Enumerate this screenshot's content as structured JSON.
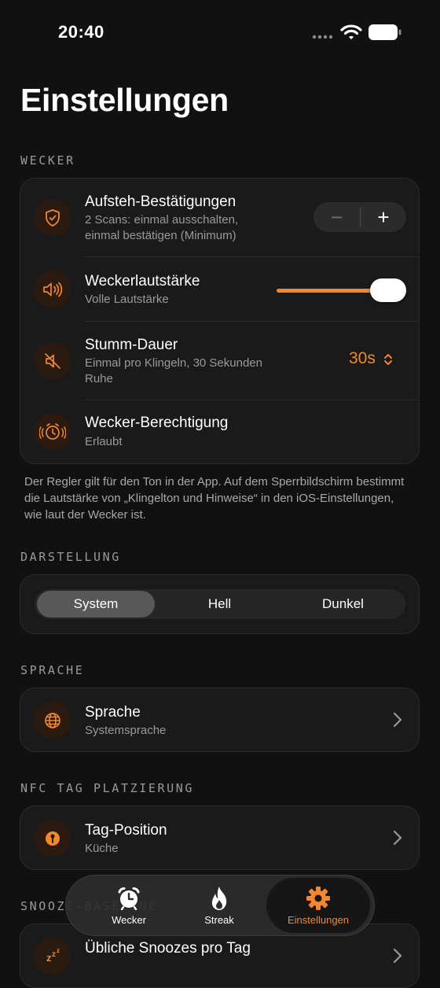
{
  "status_bar": {
    "time": "20:40"
  },
  "page_title": "Einstellungen",
  "sections": {
    "wecker": {
      "label": "WECKER",
      "rows": [
        {
          "icon": "shield-check-icon",
          "title": "Aufsteh-Bestätigungen",
          "subtitle": "2 Scans: einmal ausschalten,\neinmal bestätigen (Minimum)",
          "stepper": {
            "minus": "−",
            "plus": "+"
          }
        },
        {
          "icon": "speaker-volume-icon",
          "title": "Weckerlautstärke",
          "subtitle": "Volle Lautstärke",
          "slider_value": 1.0
        },
        {
          "icon": "muted-speaker-icon",
          "title": "Stumm-Dauer",
          "subtitle": "Einmal pro Klingeln, 30 Sekunden\nRuhe",
          "value": "30s"
        },
        {
          "icon": "alarm-clock-icon",
          "title": "Wecker-Berechtigung",
          "subtitle": "Erlaubt"
        }
      ],
      "footnote": "Der Regler gilt für den Ton in der App. Auf dem Sperrbildschirm bestimmt die Lautstärke von „Klingelton und Hinweise“ in den iOS-Einstellungen, wie laut der Wecker ist."
    },
    "darstellung": {
      "label": "DARSTELLUNG",
      "options": [
        "System",
        "Hell",
        "Dunkel"
      ],
      "selected": "System"
    },
    "sprache": {
      "label": "SPRACHE",
      "row": {
        "icon": "globe-icon",
        "title": "Sprache",
        "subtitle": "Systemsprache"
      }
    },
    "nfc": {
      "label": "NFC TAG PLATZIERUNG",
      "row": {
        "icon": "pin-icon",
        "title": "Tag-Position",
        "subtitle": "Küche"
      }
    },
    "snooze": {
      "label": "SNOOZE-BASELINE",
      "row": {
        "icon": "snooze-icon",
        "title": "Übliche Snoozes pro Tag"
      }
    }
  },
  "tab_bar": {
    "tabs": [
      {
        "label": "Wecker",
        "icon": "alarm-clock-icon"
      },
      {
        "label": "Streak",
        "icon": "flame-icon"
      },
      {
        "label": "Einstellungen",
        "icon": "gear-icon"
      }
    ],
    "active": "Einstellungen"
  },
  "colors": {
    "accent": "#f3862f",
    "background": "#111111",
    "card": "#1a1a1a"
  }
}
